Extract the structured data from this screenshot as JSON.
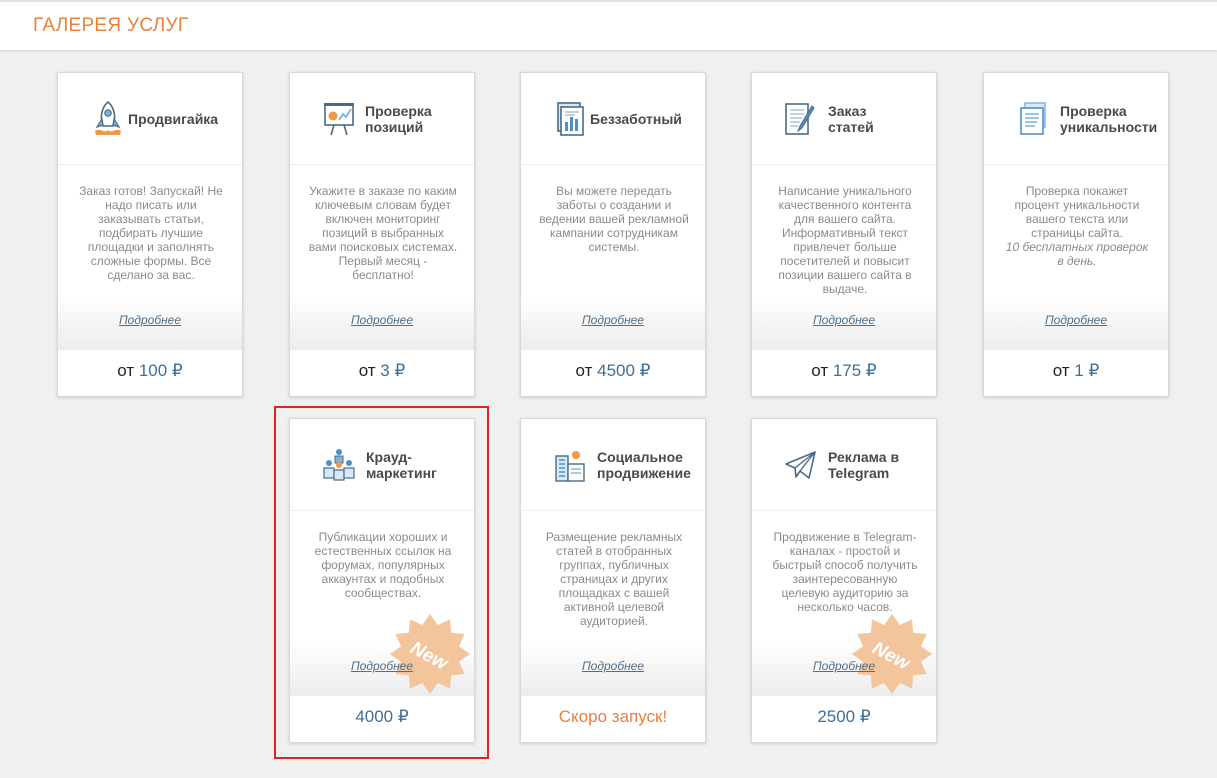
{
  "page": {
    "title": "ГАЛЕРЕЯ УСЛУГ"
  },
  "cards": [
    {
      "title": "Продвигайка",
      "icon": "rocket-icon",
      "description": "Заказ готов! Запускай! Не надо писать или заказывать статьи, подбирать лучшие площадки и заполнять сложные формы. Все сделано за вас.",
      "more": "Подробнее",
      "price_prefix": "от",
      "price_value": "100 ₽"
    },
    {
      "title": "Проверка позиций",
      "icon": "presentation-chart-icon",
      "description": "Укажите в заказе по каким ключевым словам будет включен мониторинг позиций в выбранных вами поисковых системах. Первый месяц - бесплатно!",
      "more": "Подробнее",
      "price_prefix": "от",
      "price_value": "3 ₽"
    },
    {
      "title": "Беззаботный",
      "icon": "report-document-icon",
      "description": "Вы можете передать заботы о создании и ведении вашей рекламной кампании сотрудникам системы.",
      "more": "Подробнее",
      "price_prefix": "от",
      "price_value": "4500 ₽"
    },
    {
      "title": "Заказ статей",
      "icon": "article-pen-icon",
      "description": "Написание уникального качественного контента для вашего сайта. Информативный текст привлечет больше посетителей и повысит позиции вашего сайта в выдаче.",
      "more": "Подробнее",
      "price_prefix": "от",
      "price_value": "175 ₽"
    },
    {
      "title": "Проверка уникальности",
      "icon": "documents-stack-icon",
      "description": "Проверка покажет процент уникальности вашего текста или страницы сайта.",
      "note": "10 бесплатных проверок в день.",
      "more": "Подробнее",
      "price_prefix": "от",
      "price_value": "1 ₽"
    },
    {
      "title": "Крауд-маркетинг",
      "icon": "crowd-people-icon",
      "description": "Публикации хороших и естественных ссылок на форумах, популярных аккаунтах и подобных сообществах.",
      "more": "Подробнее",
      "price_value": "4000 ₽",
      "badge": "New"
    },
    {
      "title": "Социальное продвижение",
      "icon": "buildings-icon",
      "description": "Размещение рекламных статей в отобранных группах, публичных страницах и других площадках с вашей активной целевой аудиторией.",
      "more": "Подробнее",
      "price_soon": "Скоро запуск!"
    },
    {
      "title": "Реклама в Telegram",
      "icon": "telegram-plane-icon",
      "description": "Продвижение в Telegram-каналах - простой и быстрый способ получить заинтересованную целевую аудиторию за несколько часов.",
      "more": "Подробнее",
      "price_value": "2500 ₽",
      "badge": "New"
    }
  ]
}
